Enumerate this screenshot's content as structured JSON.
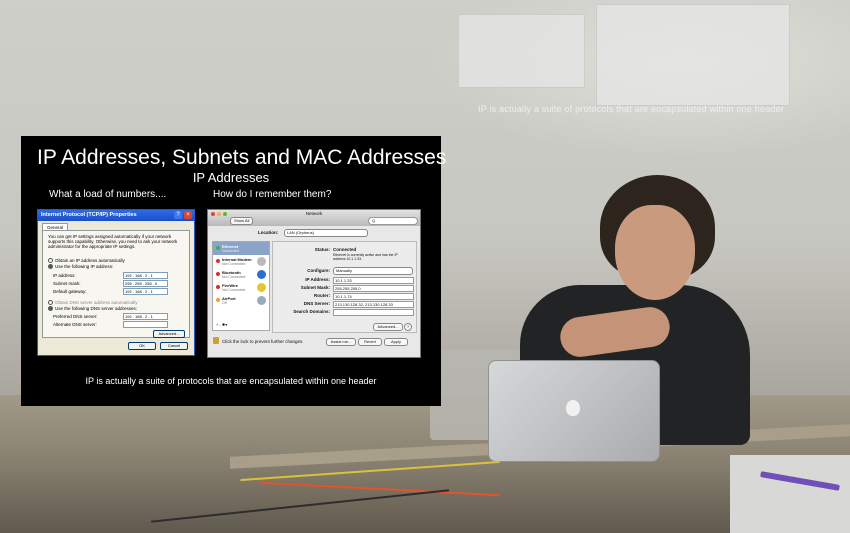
{
  "background_projection": {
    "caption": "IP is actually a suite of protocols that are encapsulated within one header"
  },
  "slide": {
    "title": "IP Addresses, Subnets and MAC Addresses",
    "subtitle": "IP Addresses",
    "left_heading": "What a load of numbers....",
    "right_heading": "How do I remember them?",
    "footer": "IP is actually a suite of protocols that are encapsulated within one header"
  },
  "windows_dialog": {
    "title": "Internet Protocol (TCP/IP) Properties",
    "tab": "General",
    "intro": "You can get IP settings assigned automatically if your network supports this capability. Otherwise, you need to ask your network administrator for the appropriate IP settings.",
    "opt_auto_ip": "Obtain an IP address automatically",
    "opt_manual_ip": "Use the following IP address:",
    "ip_label": "IP address:",
    "ip_value": "192 . 168 . 2 . 1",
    "mask_label": "Subnet mask:",
    "mask_value": "255 . 255 . 255 . 0",
    "gateway_label": "Default gateway:",
    "gateway_value": "192 . 168 . 2 . 1",
    "opt_auto_dns": "Obtain DNS server address automatically",
    "opt_manual_dns": "Use the following DNS server addresses:",
    "pref_dns_label": "Preferred DNS server:",
    "pref_dns_value": "192 . 168 . 2 . 1",
    "alt_dns_label": "Alternate DNS server:",
    "advanced": "Advanced...",
    "ok": "OK",
    "cancel": "Cancel"
  },
  "mac_dialog": {
    "title": "Network",
    "show_all": "Show All",
    "search_placeholder": "Q",
    "location_label": "Location:",
    "location_value": "LAN (Orpheus)",
    "services": [
      {
        "name": "Ethernet",
        "status": "Connected",
        "dot": "#2fb84a"
      },
      {
        "name": "Internal Modem",
        "status": "Not Connected",
        "dot": "#d8302a"
      },
      {
        "name": "Bluetooth",
        "status": "Not Connected",
        "dot": "#d8302a"
      },
      {
        "name": "FireWire",
        "status": "Not Connected",
        "dot": "#d8302a"
      },
      {
        "name": "AirPort",
        "status": "Off",
        "dot": "#e8a62a"
      }
    ],
    "status_label": "Status:",
    "status_value": "Connected",
    "status_detail": "Ethernet is currently active and has the IP address 10.1.1.33.",
    "configure_label": "Configure:",
    "configure_value": "Manually",
    "ip_label": "IP Address:",
    "ip_value": "10.1.1.33",
    "mask_label": "Subnet Mask:",
    "mask_value": "255.255.255.0",
    "router_label": "Router:",
    "router_value": "10.1.1.74",
    "dns_label": "DNS Server:",
    "dns_value": "213.130.128.32, 213.130.128.33",
    "search_domains_label": "Search Domains:",
    "advanced": "Advanced...",
    "help": "?",
    "lock_text": "Click the lock to prevent further changes.",
    "assist": "Assist me...",
    "revert": "Revert",
    "apply": "Apply",
    "add_remove": "+  -  ✱▾"
  }
}
